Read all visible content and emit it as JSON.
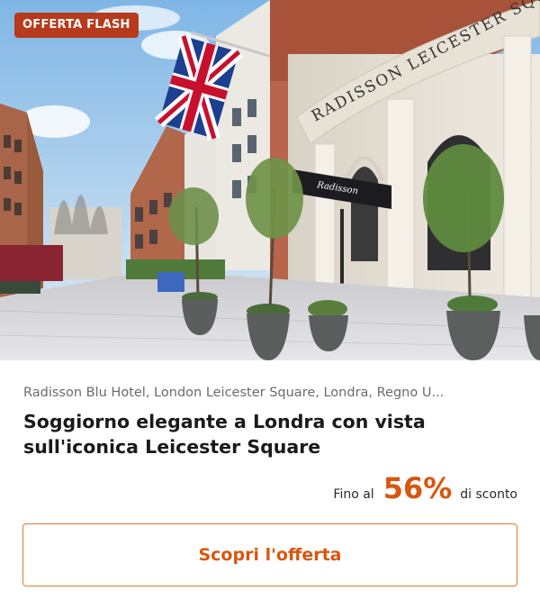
{
  "badge": {
    "label": "OFFERTA FLASH",
    "color": "#b83a1c"
  },
  "hero": {
    "image": "hotel-exterior-photo",
    "sign_text": "RADISSON LEICESTER SQUARE",
    "canopy_text": "Radisson"
  },
  "offer": {
    "location": "Radisson Blu Hotel, London Leicester Square, Londra, Regno U...",
    "title": "Soggiorno elegante a Londra con vista sull'iconica Leicester Square",
    "discount_prefix": "Fino al",
    "discount_value": "56%",
    "discount_suffix": "di sconto",
    "accent_color": "#d9560f"
  },
  "cta": {
    "label": "Scopri l'offerta"
  }
}
